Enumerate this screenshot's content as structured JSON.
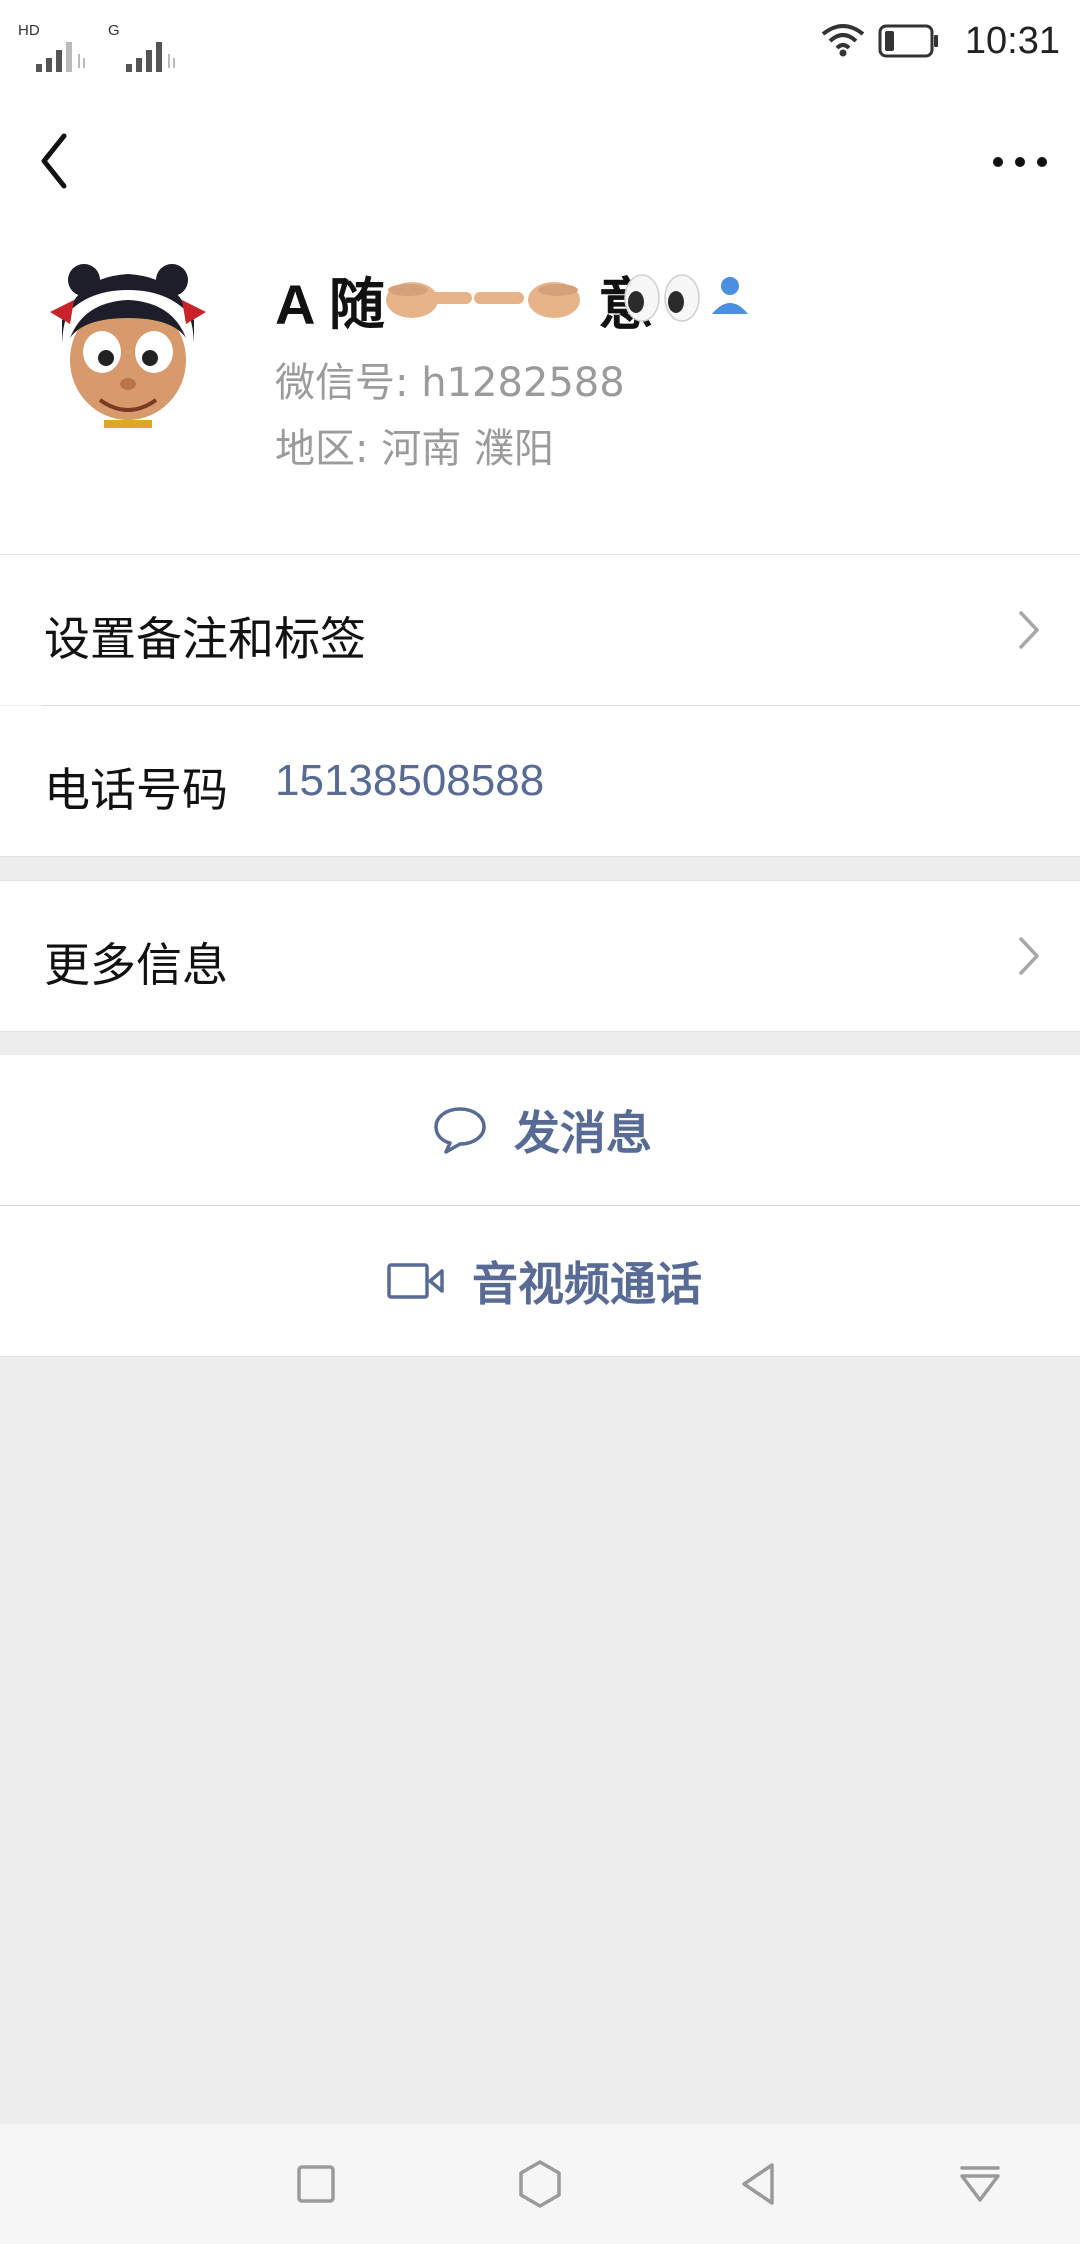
{
  "status_bar": {
    "sim1_label": "HD",
    "sim2_label": "G",
    "time": "10:31",
    "icons": [
      "signal-icon",
      "wifi-icon",
      "battery-icon"
    ]
  },
  "header": {
    "back_icon": "back-arrow-icon",
    "more_icon": "more-icon"
  },
  "profile": {
    "name_text": "A 随",
    "name_suffix_text": "意",
    "name_emojis": [
      "finger-pointing-right-icon",
      "finger-pointing-left-icon",
      "eyes-icon",
      "contact-person-icon"
    ],
    "wechat_id": "微信号: h1282588",
    "region": "地区: 河南  濮阳"
  },
  "rows": {
    "remark_label": "设置备注和标签",
    "phone_label": "电话号码",
    "phone_value": "15138508588",
    "more_info_label": "更多信息"
  },
  "actions": {
    "message_label": "发消息",
    "call_label": "音视频通话"
  },
  "colors": {
    "link": "#576b95",
    "background": "#ededed",
    "subtext": "#9b9b9b"
  }
}
